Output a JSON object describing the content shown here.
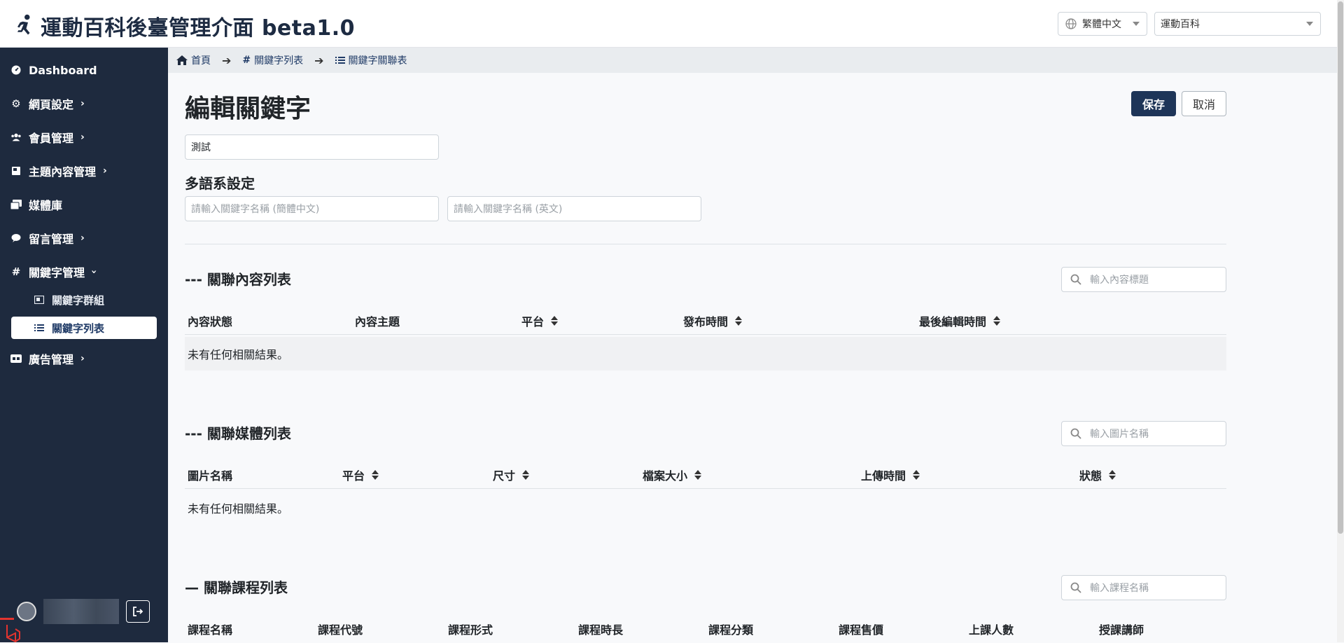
{
  "header": {
    "title": "運動百科後臺管理介面 beta1.0",
    "language": "繁體中文",
    "site": "運動百科"
  },
  "sidebar": {
    "items": [
      {
        "label": "Dashboard",
        "icon": "dashboard-icon"
      },
      {
        "label": "網頁設定",
        "icon": "gear-icon"
      },
      {
        "label": "會員管理",
        "icon": "users-icon"
      },
      {
        "label": "主題內容管理",
        "icon": "book-icon"
      },
      {
        "label": "媒體庫",
        "icon": "images-icon"
      },
      {
        "label": "留言管理",
        "icon": "comment-icon"
      },
      {
        "label": "關鍵字管理",
        "icon": "hashtag-icon"
      },
      {
        "label": "廣告管理",
        "icon": "ad-icon"
      }
    ],
    "sub_items": [
      {
        "label": "關鍵字群組",
        "icon": "image-group-icon",
        "active": false
      },
      {
        "label": "關鍵字列表",
        "icon": "list-icon",
        "active": true
      }
    ]
  },
  "breadcrumb": {
    "home": "首頁",
    "keyword_list": "關鍵字列表",
    "keyword_relation": "關鍵字關聯表"
  },
  "main": {
    "title": "編輯關鍵字",
    "save_label": "保存",
    "cancel_label": "取消",
    "keyword_value": "測試",
    "multilang_title": "多語系設定",
    "placeholder_sc": "請輸入關鍵字名稱 (簡體中文)",
    "placeholder_en": "請輸入關鍵字名稱 (英文)"
  },
  "content_section": {
    "title": "--- 關聯內容列表",
    "search_placeholder": "輸入內容標題",
    "columns": [
      "內容狀態",
      "內容主題",
      "平台",
      "發布時間",
      "最後編輯時間"
    ],
    "empty": "未有任何相關結果。"
  },
  "media_section": {
    "title": "--- 關聯媒體列表",
    "search_placeholder": "輸入圖片名稱",
    "columns": [
      "圖片名稱",
      "平台",
      "尺寸",
      "檔案大小",
      "上傳時間",
      "狀態"
    ],
    "empty": "未有任何相關結果。"
  },
  "course_section": {
    "title": "— 關聯課程列表",
    "search_placeholder": "輸入課程名稱",
    "columns": [
      "課程名稱",
      "課程代號",
      "課程形式",
      "課程時長",
      "課程分類",
      "課程售價",
      "上課人數",
      "授課講師"
    ]
  },
  "colors": {
    "sidebar_bg": "#1e2a3e",
    "primary": "#1e3558",
    "header_title": "#1d2b42"
  }
}
